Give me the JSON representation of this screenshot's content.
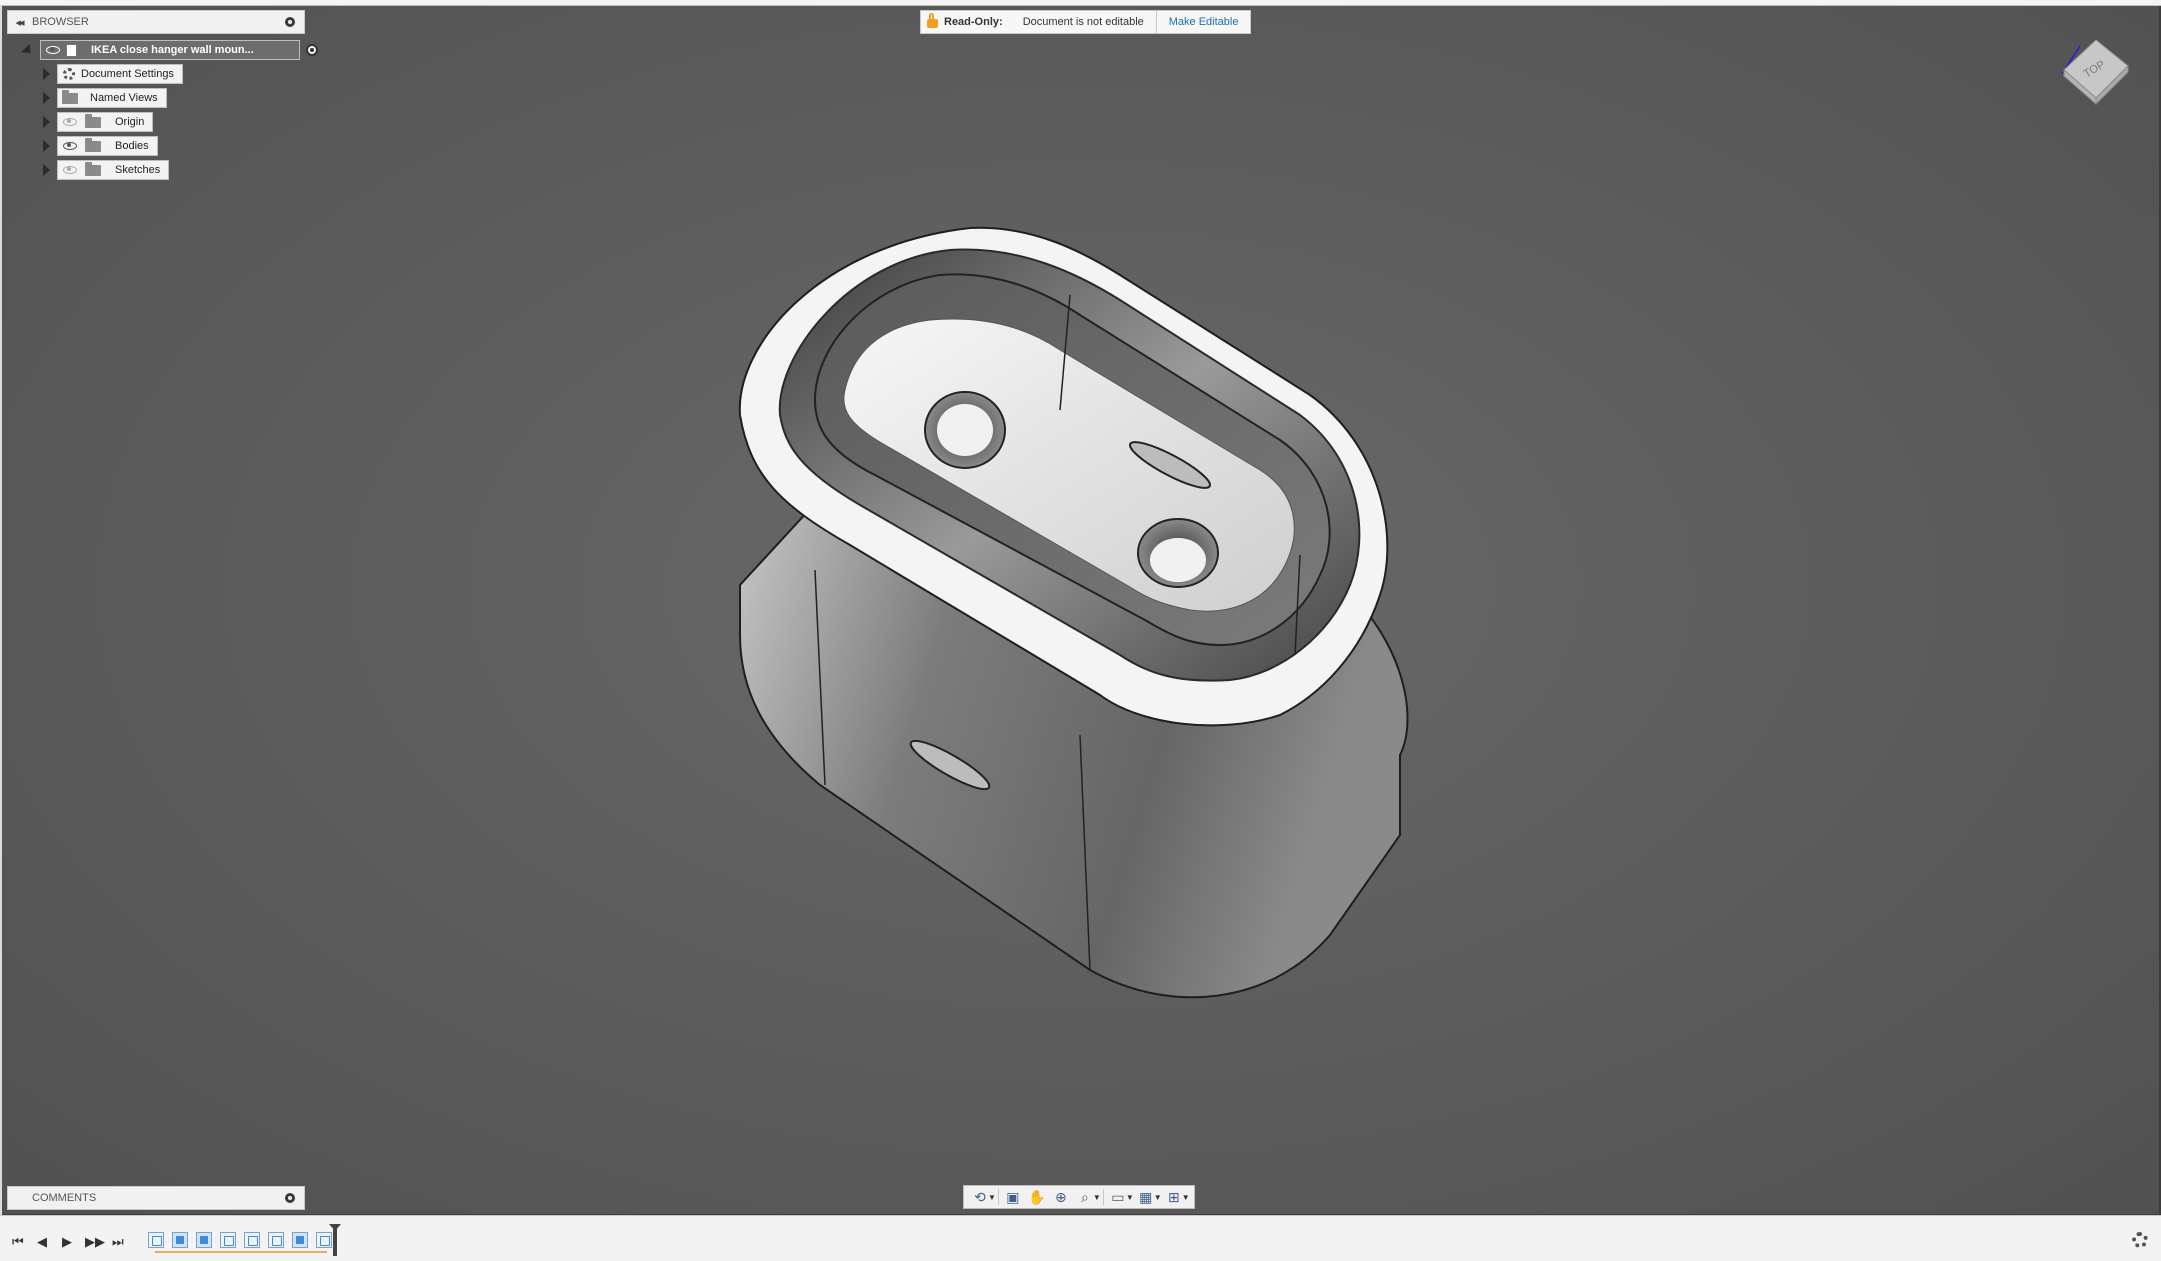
{
  "browser": {
    "title": "BROWSER",
    "collapse_label": "◂◂",
    "root": {
      "label": "IKEA close hanger wall moun..."
    },
    "items": [
      {
        "label": "Document Settings",
        "icon": "gear-icon"
      },
      {
        "label": "Named Views",
        "icon": "folder-icon"
      },
      {
        "label": "Origin",
        "icon": "folder-icon",
        "visibility": "hidden"
      },
      {
        "label": "Bodies",
        "icon": "folder-icon",
        "visibility": "visible"
      },
      {
        "label": "Sketches",
        "icon": "folder-icon",
        "visibility": "hidden"
      }
    ]
  },
  "banner": {
    "label": "Read-Only:",
    "message": "Document is not editable",
    "button": "Make Editable"
  },
  "viewcube": {
    "face": "TOP"
  },
  "comments": {
    "title": "COMMENTS"
  },
  "navbar": {
    "tools": [
      "orbit-icon",
      "look-at-icon",
      "pan-icon",
      "zoom-icon",
      "fit-icon",
      "display-settings-icon",
      "grid-icon",
      "viewports-icon"
    ]
  },
  "timeline": {
    "controls": [
      "⏮",
      "◀",
      "▶",
      "▶▶",
      "⏭"
    ],
    "features": [
      "sketch",
      "extrude",
      "extrude",
      "sketch",
      "hole",
      "sketch",
      "extrude",
      "fillet"
    ]
  },
  "colors": {
    "viewport_bg": "#5e5e5e",
    "panel_bg": "#f1f1f1",
    "accent_link": "#1a6fb5",
    "lock_orange": "#f0a020"
  }
}
